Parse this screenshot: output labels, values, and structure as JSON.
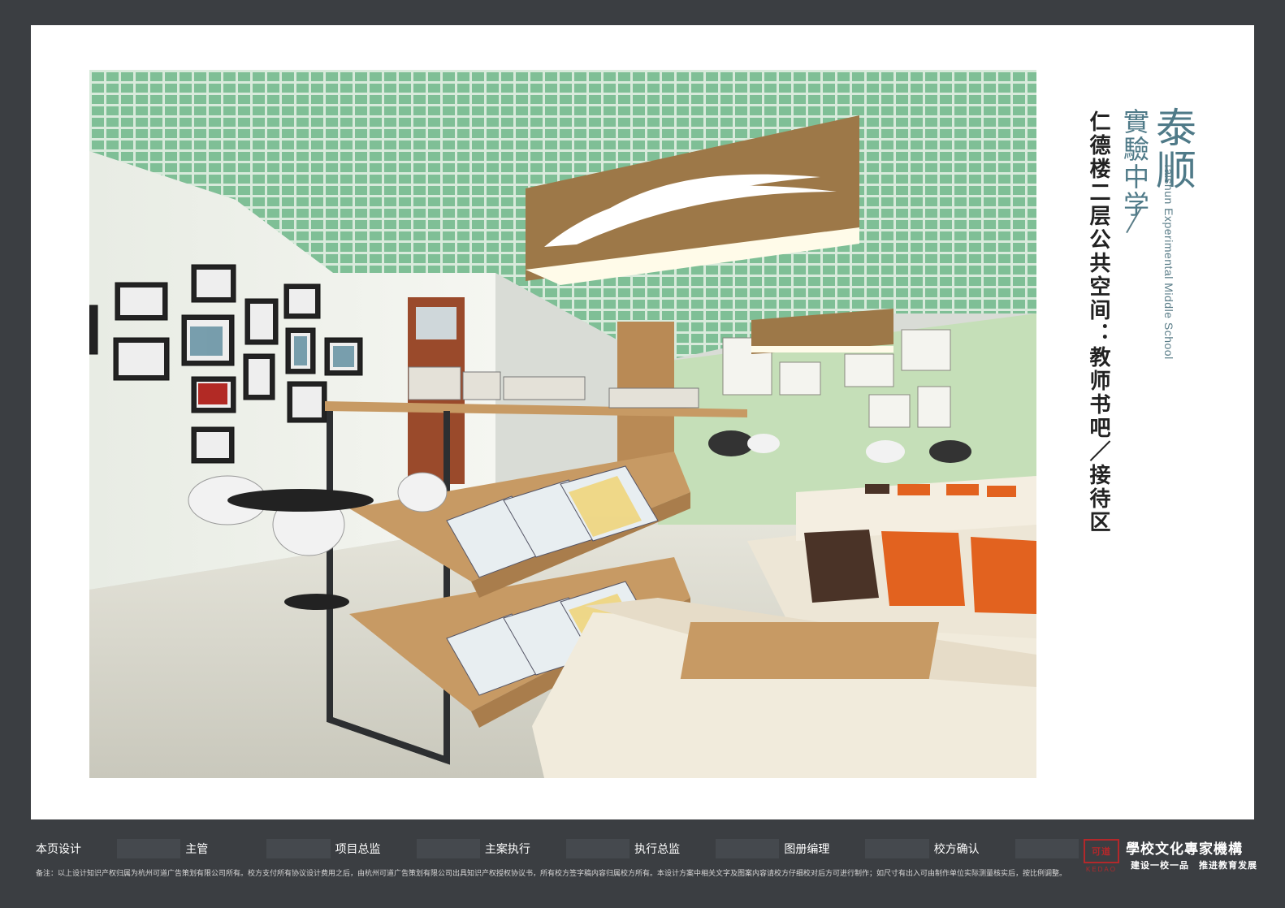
{
  "brand": {
    "cn_large": "泰顺",
    "cn_sub": "實驗中学",
    "en": "Taishun Experimental Middle School"
  },
  "space_title": "仁德楼二层公共空间：教师书吧／接待区",
  "render": {
    "description_icon": "interior-render-image",
    "colors": {
      "ceiling_grid": "#7fbf96",
      "wall": "#eef0ea",
      "wood": "#b98a55",
      "sofa": "#ece4d3",
      "pillow_orange": "#e2621f",
      "pillow_brown": "#4a3327",
      "frame_metal": "#2d2f31"
    }
  },
  "footer": {
    "cells": [
      "本页设计",
      "主管",
      "项目总监",
      "主案执行",
      "执行总监",
      "图册编理",
      "校方确认"
    ],
    "note": "备注：以上设计知识产权归属为杭州可道广告策划有限公司所有。校方支付所有协议设计费用之后，由杭州可道广告策划有限公司出具知识产权授权协议书，所有校方签字稿内容归属校方所有。本设计方案中相关文字及图案内容请校方仔细校对后方可进行制作；如尺寸有出入可由制作单位实际测量核实后，按比例调整。",
    "org_name": "學校文化專家機構",
    "org_slogan": "建设一校一品　推进教育发展",
    "seal_icon": "red-seal-logo"
  }
}
